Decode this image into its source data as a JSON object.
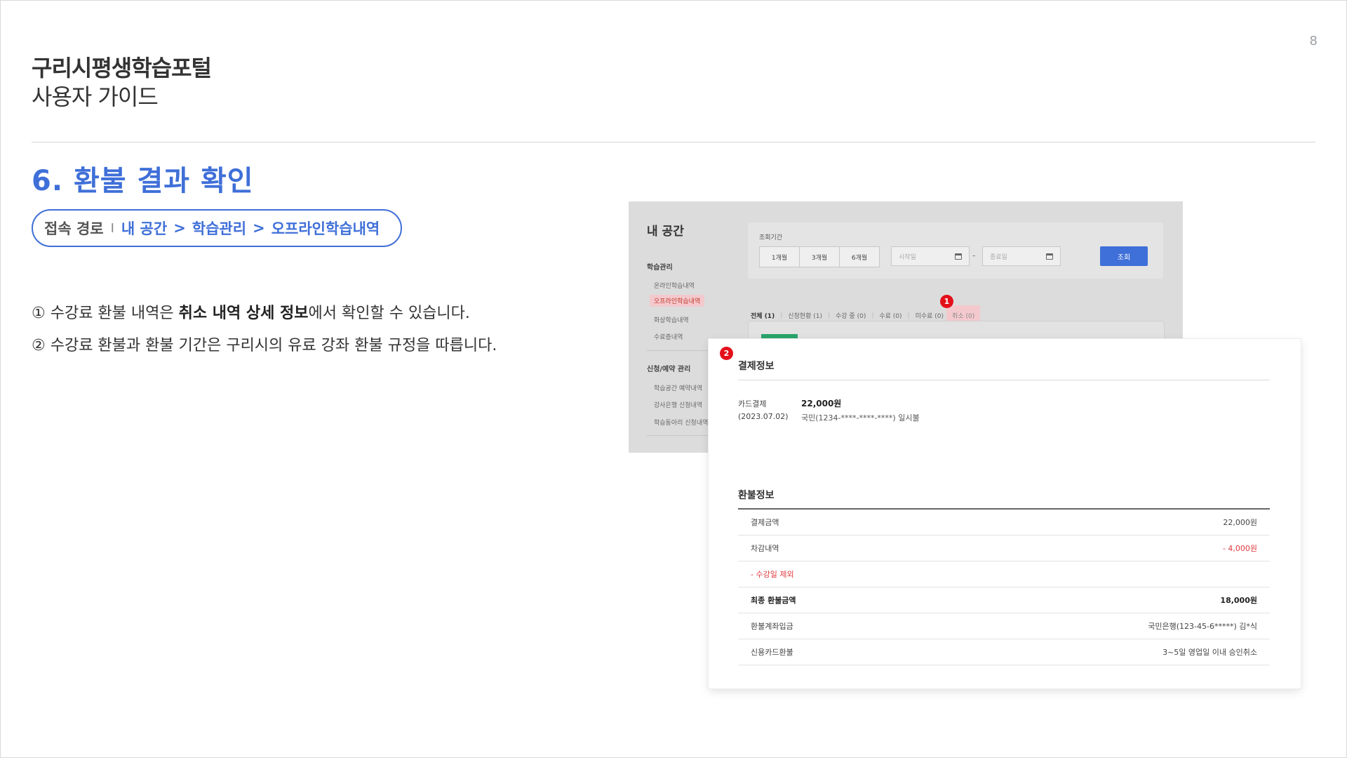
{
  "page_number": "8",
  "doc": {
    "title": "구리시평생학습포털",
    "subtitle": "사용자 가이드"
  },
  "section": {
    "title": "6. 환불 결과 확인",
    "path_label": "접속 경로",
    "path_separator": "I",
    "path": [
      "내 공간",
      "학습관리",
      "오프라인학습내역"
    ],
    "path_arrow": ">"
  },
  "descriptions": [
    {
      "prefix": "① 수강료 환불 내역은 ",
      "bold": "취소 내역 상세 정보",
      "suffix": "에서 확인할 수 있습니다."
    },
    {
      "prefix": "② 수강료 환불과 환불 기간은 구리시의 유료 강좌 환불 규정을 따릅니다.",
      "bold": "",
      "suffix": ""
    }
  ],
  "screenshot": {
    "heading": "내 공간",
    "sidebar": {
      "group1": "학습관리",
      "items1": [
        "온라인학습내역",
        "오프라인학습내역",
        "화상학습내역",
        "수료증내역"
      ],
      "group2": "신청/예약 관리",
      "items2": [
        "학습공간 예약내역",
        "강사은행 신청내역",
        "학습동아리 신청내역"
      ]
    },
    "period_label": "조회기간",
    "periods": [
      "1개월",
      "3개월",
      "6개월"
    ],
    "start_placeholder": "시작일",
    "end_placeholder": "종료일",
    "date_dash": "-",
    "search_label": "조회",
    "tabs": [
      "전체 (1)",
      "신청현황 (1)",
      "수강 중 (0)",
      "수료 (0)",
      "미수료 (0)",
      "취소 (0)"
    ],
    "marker1": "1",
    "marker2": "2"
  },
  "card": {
    "payment_title": "결제정보",
    "payment_method": "카드결제",
    "payment_date": "(2023.07.02)",
    "payment_amount": "22,000원",
    "payment_card": "국민(1234-****-****-****) 일시불",
    "refund_title": "환불정보",
    "refund_rows": [
      {
        "label": "결제금액",
        "value": "22,000원"
      },
      {
        "label": "차감내역",
        "value": "- 4,000원"
      },
      {
        "label": "- 수강일 제외",
        "value": ""
      },
      {
        "label": "최종 환불금액",
        "value": "18,000원"
      },
      {
        "label": "환불계좌입금",
        "value": "국민은행(123-45-6*****) 김*식"
      },
      {
        "label": "신용카드환불",
        "value": "3~5일 영업일 이내 승인취소"
      }
    ]
  },
  "colors": {
    "accent": "#3f6fd8",
    "marker": "#e3101a",
    "deduction": "#e0393e",
    "highlight": "#f4c9cd"
  }
}
